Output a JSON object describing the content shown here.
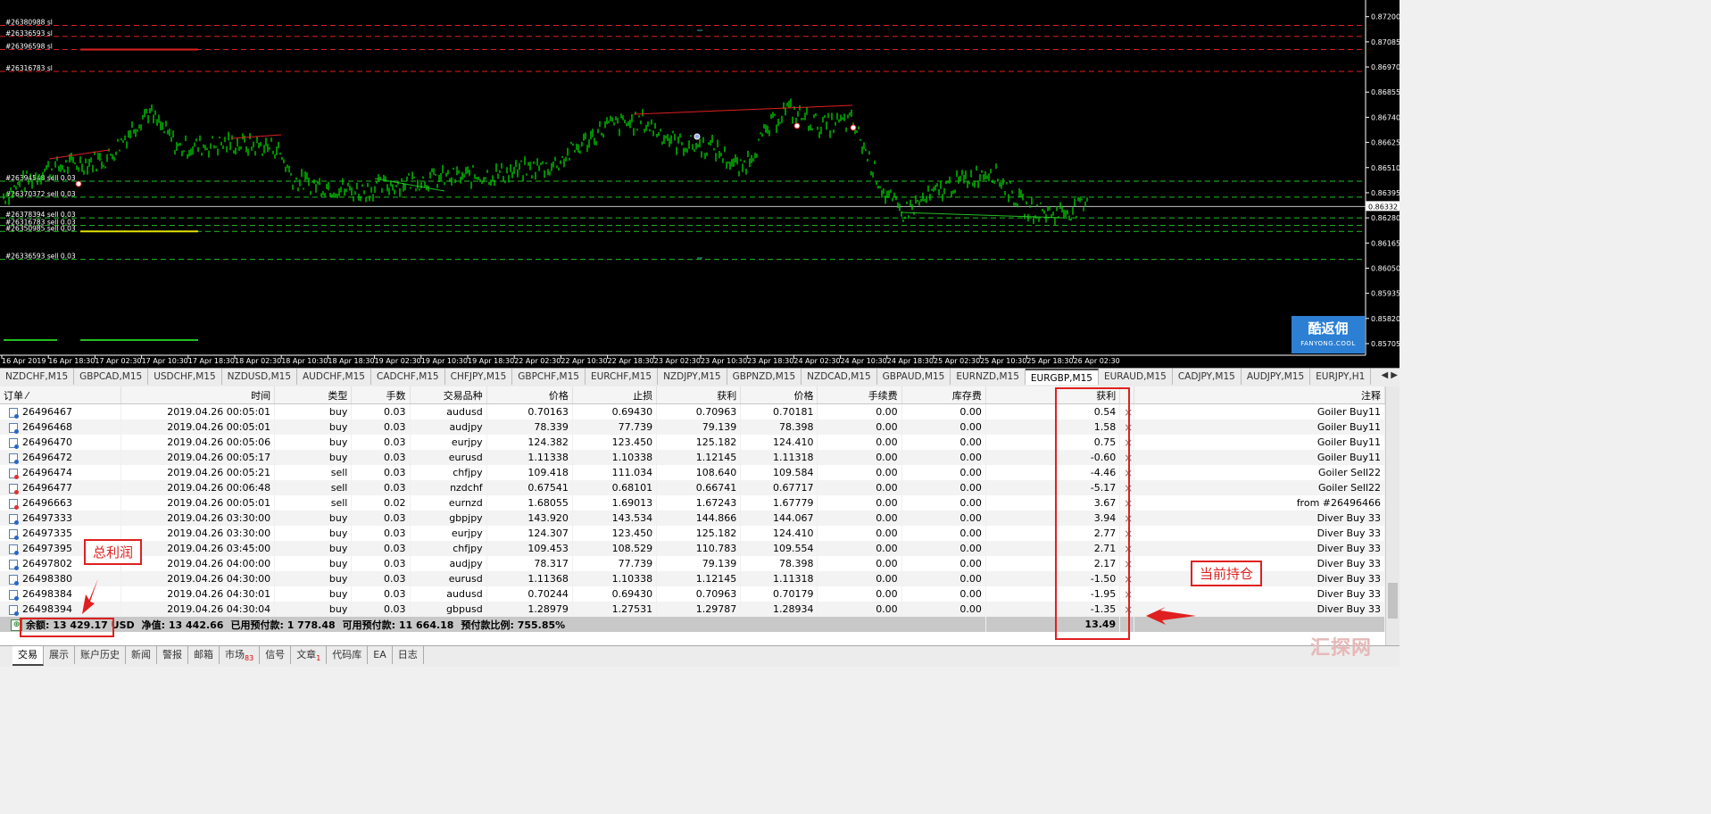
{
  "chart": {
    "price_levels": [
      "0.87200",
      "0.87085",
      "0.86970",
      "0.86855",
      "0.86740",
      "0.86625",
      "0.86510",
      "0.86395",
      "0.86280",
      "0.86165",
      "0.86050",
      "0.85935",
      "0.85820",
      "0.85705"
    ],
    "current_price": "0.86332",
    "time_labels": [
      "16 Apr 2019",
      "16 Apr 18:30",
      "17 Apr 02:30",
      "17 Apr 10:30",
      "17 Apr 18:30",
      "18 Apr 02:30",
      "18 Apr 10:30",
      "18 Apr 18:30",
      "19 Apr 02:30",
      "19 Apr 10:30",
      "19 Apr 18:30",
      "22 Apr 02:30",
      "22 Apr 10:30",
      "22 Apr 18:30",
      "23 Apr 02:30",
      "23 Apr 10:30",
      "23 Apr 18:30",
      "24 Apr 02:30",
      "24 Apr 10:30",
      "24 Apr 18:30",
      "25 Apr 02:30",
      "25 Apr 10:30",
      "25 Apr 18:30",
      "26 Apr 02:30"
    ],
    "order_labels": [
      "#26380988 sl",
      "#26336593 sl",
      "#26396598 sl",
      "#26316783 sl",
      "#26394548 sell 0.03",
      "#26370372 sell 0.03",
      "#26378394 sell 0.03",
      "#26316783 sell 0.03",
      "#26350985 sell 0.03",
      "#26336593 sell 0.03"
    ],
    "line_colors": {
      "sl": "#e02020",
      "order": "#22c022",
      "candles": "#00c800",
      "bid": "#c0c0c0"
    }
  },
  "logo": {
    "title": "酷返佣",
    "subtitle": "FANYONG.COOL"
  },
  "chart_tabs": [
    "NZDCHF,M15",
    "GBPCAD,M15",
    "USDCHF,M15",
    "NZDUSD,M15",
    "AUDCHF,M15",
    "CADCHF,M15",
    "CHFJPY,M15",
    "GBPCHF,M15",
    "EURCHF,M15",
    "NZDJPY,M15",
    "GBPNZD,M15",
    "NZDCAD,M15",
    "GBPAUD,M15",
    "EURNZD,M15",
    "EURGBP,M15",
    "EURAUD,M15",
    "CADJPY,M15",
    "AUDJPY,M15",
    "EURJPY,H1"
  ],
  "active_chart_tab": "EURGBP,M15",
  "table": {
    "headers": [
      "订单",
      "时间",
      "类型",
      "手数",
      "交易品种",
      "价格",
      "止损",
      "获利",
      "价格",
      "手续费",
      "库存费",
      "获利",
      "注释"
    ],
    "rows": [
      {
        "order": "26496467",
        "time": "2019.04.26 00:05:01",
        "type": "buy",
        "lots": "0.03",
        "symbol": "audusd",
        "price": "0.70163",
        "sl": "0.69430",
        "tp": "0.70963",
        "cur": "0.70181",
        "comm": "0.00",
        "swap": "0.00",
        "profit": "0.54",
        "comment": "Goiler Buy11"
      },
      {
        "order": "26496468",
        "time": "2019.04.26 00:05:01",
        "type": "buy",
        "lots": "0.03",
        "symbol": "audjpy",
        "price": "78.339",
        "sl": "77.739",
        "tp": "79.139",
        "cur": "78.398",
        "comm": "0.00",
        "swap": "0.00",
        "profit": "1.58",
        "comment": "Goiler Buy11"
      },
      {
        "order": "26496470",
        "time": "2019.04.26 00:05:06",
        "type": "buy",
        "lots": "0.03",
        "symbol": "eurjpy",
        "price": "124.382",
        "sl": "123.450",
        "tp": "125.182",
        "cur": "124.410",
        "comm": "0.00",
        "swap": "0.00",
        "profit": "0.75",
        "comment": "Goiler Buy11"
      },
      {
        "order": "26496472",
        "time": "2019.04.26 00:05:17",
        "type": "buy",
        "lots": "0.03",
        "symbol": "eurusd",
        "price": "1.11338",
        "sl": "1.10338",
        "tp": "1.12145",
        "cur": "1.11318",
        "comm": "0.00",
        "swap": "0.00",
        "profit": "-0.60",
        "comment": "Goiler Buy11"
      },
      {
        "order": "26496474",
        "time": "2019.04.26 00:05:21",
        "type": "sell",
        "lots": "0.03",
        "symbol": "chfjpy",
        "price": "109.418",
        "sl": "111.034",
        "tp": "108.640",
        "cur": "109.584",
        "comm": "0.00",
        "swap": "0.00",
        "profit": "-4.46",
        "comment": "Goiler Sell22"
      },
      {
        "order": "26496477",
        "time": "2019.04.26 00:06:48",
        "type": "sell",
        "lots": "0.03",
        "symbol": "nzdchf",
        "price": "0.67541",
        "sl": "0.68101",
        "tp": "0.66741",
        "cur": "0.67717",
        "comm": "0.00",
        "swap": "0.00",
        "profit": "-5.17",
        "comment": "Goiler Sell22"
      },
      {
        "order": "26496663",
        "time": "2019.04.26 00:05:01",
        "type": "sell",
        "lots": "0.02",
        "symbol": "eurnzd",
        "price": "1.68055",
        "sl": "1.69013",
        "tp": "1.67243",
        "cur": "1.67779",
        "comm": "0.00",
        "swap": "0.00",
        "profit": "3.67",
        "comment": "from #26496466"
      },
      {
        "order": "26497333",
        "time": "2019.04.26 03:30:00",
        "type": "buy",
        "lots": "0.03",
        "symbol": "gbpjpy",
        "price": "143.920",
        "sl": "143.534",
        "tp": "144.866",
        "cur": "144.067",
        "comm": "0.00",
        "swap": "0.00",
        "profit": "3.94",
        "comment": "Diver Buy 33"
      },
      {
        "order": "26497335",
        "time": "2019.04.26 03:30:00",
        "type": "buy",
        "lots": "0.03",
        "symbol": "eurjpy",
        "price": "124.307",
        "sl": "123.450",
        "tp": "125.182",
        "cur": "124.410",
        "comm": "0.00",
        "swap": "0.00",
        "profit": "2.77",
        "comment": "Diver Buy 33"
      },
      {
        "order": "26497395",
        "time": "2019.04.26 03:45:00",
        "type": "buy",
        "lots": "0.03",
        "symbol": "chfjpy",
        "price": "109.453",
        "sl": "108.529",
        "tp": "110.783",
        "cur": "109.554",
        "comm": "0.00",
        "swap": "0.00",
        "profit": "2.71",
        "comment": "Diver Buy 33"
      },
      {
        "order": "26497802",
        "time": "2019.04.26 04:00:00",
        "type": "buy",
        "lots": "0.03",
        "symbol": "audjpy",
        "price": "78.317",
        "sl": "77.739",
        "tp": "79.139",
        "cur": "78.398",
        "comm": "0.00",
        "swap": "0.00",
        "profit": "2.17",
        "comment": "Diver Buy 33"
      },
      {
        "order": "26498380",
        "time": "2019.04.26 04:30:00",
        "type": "buy",
        "lots": "0.03",
        "symbol": "eurusd",
        "price": "1.11368",
        "sl": "1.10338",
        "tp": "1.12145",
        "cur": "1.11318",
        "comm": "0.00",
        "swap": "0.00",
        "profit": "-1.50",
        "comment": "Diver Buy 33"
      },
      {
        "order": "26498384",
        "time": "2019.04.26 04:30:01",
        "type": "buy",
        "lots": "0.03",
        "symbol": "audusd",
        "price": "0.70244",
        "sl": "0.69430",
        "tp": "0.70963",
        "cur": "0.70179",
        "comm": "0.00",
        "swap": "0.00",
        "profit": "-1.95",
        "comment": "Diver Buy 33"
      },
      {
        "order": "26498394",
        "time": "2019.04.26 04:30:04",
        "type": "buy",
        "lots": "0.03",
        "symbol": "gbpusd",
        "price": "1.28979",
        "sl": "1.27531",
        "tp": "1.29787",
        "cur": "1.28934",
        "comm": "0.00",
        "swap": "0.00",
        "profit": "-1.35",
        "comment": "Diver Buy 33"
      }
    ],
    "summary": {
      "balance": "余额: 13 429.17 USD",
      "equity": "净值: 13 442.66",
      "margin": "已用预付款: 1 778.48",
      "free_margin": "可用预付款: 11 664.18",
      "margin_level": "预付款比例: 755.85%",
      "total_profit": "13.49"
    }
  },
  "annotations": {
    "total_profit_label": "总利润",
    "current_positions_label": "当前持仓"
  },
  "bottom_tabs": [
    "交易",
    "展示",
    "账户历史",
    "新闻",
    "警报",
    "邮箱",
    "市场",
    "信号",
    "文章",
    "代码库",
    "EA",
    "日志"
  ],
  "bottom_badges": {
    "market": "83",
    "articles": "1"
  },
  "watermark": "汇探网"
}
